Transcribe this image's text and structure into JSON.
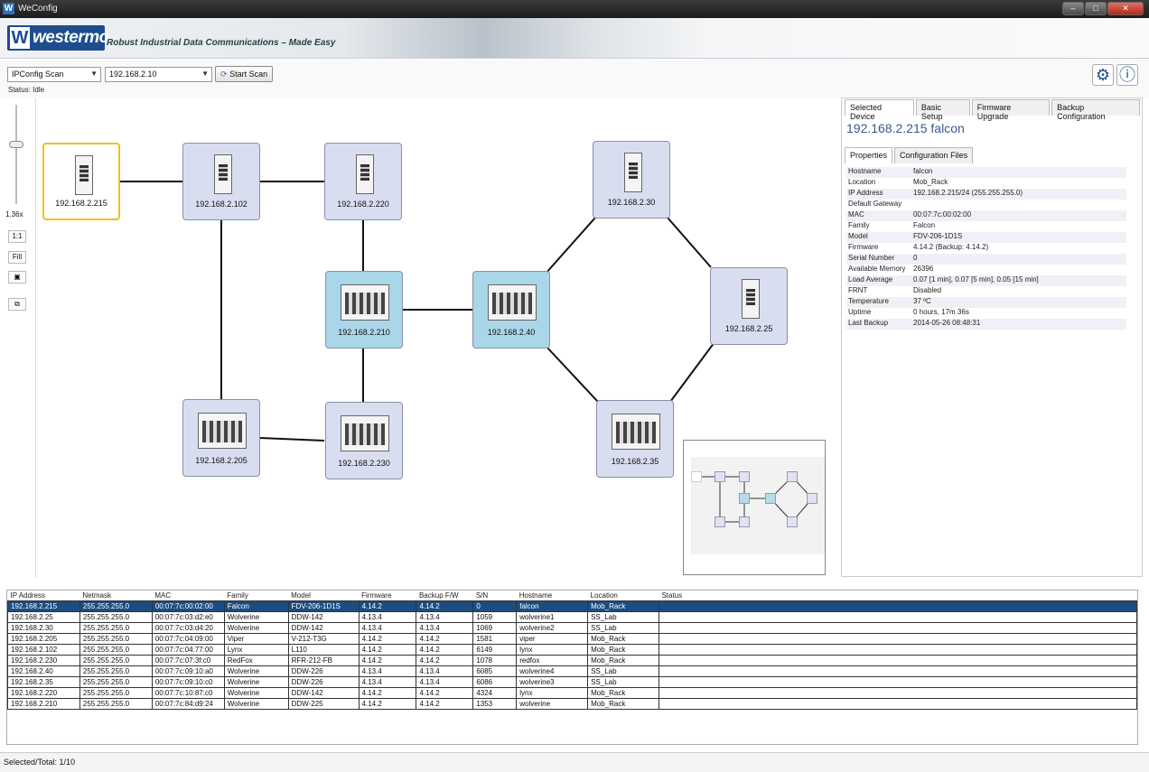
{
  "window": {
    "title": "WeConfig",
    "controls": [
      "‒",
      "□",
      "✕"
    ]
  },
  "banner": {
    "brand": "westermo",
    "tagline": "Robust Industrial Data Communications – Made Easy"
  },
  "toolbar": {
    "scan_type": "IPConfig Scan",
    "ip_range": "192.168.2.10",
    "start_scan_label": "Start Scan",
    "status_label": "Status:",
    "status_value": "Idle",
    "settings_icon": "gear-icon",
    "info_icon": "info-icon"
  },
  "zoom": {
    "level": "1.36x",
    "one_to_one": "1:1",
    "fill": "Fill"
  },
  "topology": {
    "nodes": [
      {
        "ip": "192.168.2.215",
        "state": "selected"
      },
      {
        "ip": "192.168.2.102",
        "state": "normal"
      },
      {
        "ip": "192.168.2.220",
        "state": "normal"
      },
      {
        "ip": "192.168.2.30",
        "state": "normal"
      },
      {
        "ip": "192.168.2.210",
        "state": "active"
      },
      {
        "ip": "192.168.2.40",
        "state": "active"
      },
      {
        "ip": "192.168.2.25",
        "state": "normal"
      },
      {
        "ip": "192.168.2.205",
        "state": "normal"
      },
      {
        "ip": "192.168.2.230",
        "state": "normal"
      },
      {
        "ip": "192.168.2.35",
        "state": "normal"
      }
    ]
  },
  "details": {
    "tabs": [
      "Selected Device",
      "Basic Setup",
      "Firmware Upgrade",
      "Backup Configuration"
    ],
    "heading": "192.168.2.215  falcon",
    "subtabs": [
      "Properties",
      "Configuration Files"
    ],
    "properties": [
      {
        "key": "Hostname",
        "value": "falcon"
      },
      {
        "key": "Location",
        "value": "Mob_Rack"
      },
      {
        "key": "IP Address",
        "value": "192.168.2.215/24  (255.255.255.0)"
      },
      {
        "key": "Default Gateway",
        "value": ""
      },
      {
        "key": "MAC",
        "value": "00:07:7c:00:02:00"
      },
      {
        "key": "Family",
        "value": "Falcon"
      },
      {
        "key": "Model",
        "value": "FDV-206-1D1S"
      },
      {
        "key": "Firmware",
        "value": "4.14.2 (Backup: 4.14.2)"
      },
      {
        "key": "Serial Number",
        "value": "0"
      },
      {
        "key": "Available Memory",
        "value": "26396"
      },
      {
        "key": "Load Average",
        "value": "0.07 [1 min],  0.07 [5 min],  0.05 [15 min]"
      },
      {
        "key": "FRNT",
        "value": "Disabled"
      },
      {
        "key": "Temperature",
        "value": "37 ºC"
      },
      {
        "key": "Uptime",
        "value": "0 hours, 17m 36s"
      },
      {
        "key": "Last Backup",
        "value": "2014-05-26 08:48:31"
      }
    ]
  },
  "device_table": {
    "columns": [
      "IP Address",
      "Netmask",
      "MAC",
      "Family",
      "Model",
      "Firmware",
      "Backup F/W",
      "S/N",
      "Hostname",
      "Location",
      "Status"
    ],
    "rows": [
      [
        "192.168.2.215",
        "255.255.255.0",
        "00:07:7c:00:02:00",
        "Falcon",
        "FDV-206-1D1S",
        "4.14.2",
        "4.14.2",
        "0",
        "falcon",
        "Mob_Rack",
        ""
      ],
      [
        "192.168.2.25",
        "255.255.255.0",
        "00:07:7c:03:d2:e0",
        "Wolverine",
        "DDW-142",
        "4.13.4",
        "4.13.4",
        "1059",
        "wolverine1",
        "SS_Lab",
        ""
      ],
      [
        "192.168.2.30",
        "255.255.255.0",
        "00:07:7c:03:d4:20",
        "Wolverine",
        "DDW-142",
        "4.13.4",
        "4.13.4",
        "1069",
        "wolverine2",
        "SS_Lab",
        ""
      ],
      [
        "192.168.2.205",
        "255.255.255.0",
        "00:07:7c:04:09:00",
        "Viper",
        "V-212-T3G",
        "4.14.2",
        "4.14.2",
        "1581",
        "viper",
        "Mob_Rack",
        ""
      ],
      [
        "192.168.2.102",
        "255.255.255.0",
        "00:07:7c:04:77:00",
        "Lynx",
        "L110",
        "4.14.2",
        "4.14.2",
        "6149",
        "lynx",
        "Mob_Rack",
        ""
      ],
      [
        "192.168.2.230",
        "255.255.255.0",
        "00:07:7c:07:3f:c0",
        "RedFox",
        "RFR-212-FB",
        "4.14.2",
        "4.14.2",
        "1078",
        "redfox",
        "Mob_Rack",
        ""
      ],
      [
        "192.168.2.40",
        "255.255.255.0",
        "00:07:7c:09:10:a0",
        "Wolverine",
        "DDW-226",
        "4.13.4",
        "4.13.4",
        "6085",
        "wolverine4",
        "SS_Lab",
        ""
      ],
      [
        "192.168.2.35",
        "255.255.255.0",
        "00:07:7c:09:10:c0",
        "Wolverine",
        "DDW-226",
        "4.13.4",
        "4.13.4",
        "6086",
        "wolverine3",
        "SS_Lab",
        ""
      ],
      [
        "192.168.2.220",
        "255.255.255.0",
        "00:07:7c:10:87:c0",
        "Wolverine",
        "DDW-142",
        "4.14.2",
        "4.14.2",
        "4324",
        "lynx",
        "Mob_Rack",
        ""
      ],
      [
        "192.168.2.210",
        "255.255.255.0",
        "00:07:7c:84:d9:24",
        "Wolverine",
        "DDW-225",
        "4.14.2",
        "4.14.2",
        "1353",
        "wolverine",
        "Mob_Rack",
        ""
      ]
    ]
  },
  "footer": {
    "selection": "Selected/Total: 1/10"
  }
}
